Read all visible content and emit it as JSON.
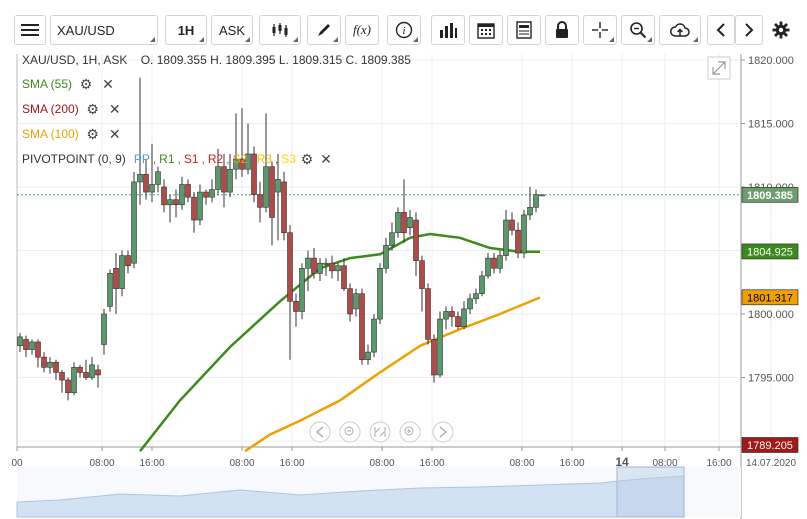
{
  "toolbar": {
    "symbol": "XAU/USD",
    "timeframe": "1H",
    "price_type": "ASK",
    "fx_label": "f(x)"
  },
  "ohlc": {
    "label": "XAU/USD, 1H, ASK",
    "text": "O. 1809.355 H. 1809.395 L. 1809.315 C. 1809.385"
  },
  "indicators": [
    {
      "label": "SMA (55)",
      "color": "#3c8a1c"
    },
    {
      "label": "SMA (200)",
      "color": "#a01818"
    },
    {
      "label": "SMA (100)",
      "color": "#f0a000"
    }
  ],
  "pivot": {
    "label": "PIVOTPOINT (0, 9)",
    "levels": [
      {
        "label": "PP",
        "color": "#4aa0e0"
      },
      {
        "label": "R1",
        "color": "#3c8a1c"
      },
      {
        "label": "S1",
        "color": "#d02020"
      },
      {
        "label": "R2",
        "color": "#d02020"
      },
      {
        "label": "S2",
        "color": "#f0a000"
      },
      {
        "label": "R3",
        "color": "#f0c000"
      },
      {
        "label": "S3",
        "color": "#f0e000"
      }
    ]
  },
  "price_axis": {
    "ticks": [
      "1820.000",
      "1815.000",
      "1810.000",
      "1805.000",
      "1800.000",
      "1795.000",
      "1790.000"
    ],
    "badges": [
      {
        "label": "1809.385",
        "price": 1809.385,
        "bg": "#6b9e6b",
        "fg": "#ffffff"
      },
      {
        "label": "1804.925",
        "price": 1804.925,
        "bg": "#3c8a1c",
        "fg": "#ffffff"
      },
      {
        "label": "1801.317",
        "price": 1801.317,
        "bg": "#f0a000",
        "fg": "#000000"
      },
      {
        "label": "1789.205",
        "price": 1789.205,
        "bg": "#a01818",
        "fg": "#ffffff"
      }
    ]
  },
  "time_axis": {
    "labels": [
      "00",
      "08:00",
      "16:00",
      "08:00",
      "16:00",
      "08:00",
      "16:00",
      "08:00",
      "16:00",
      "14",
      "08:00",
      "16:00",
      "14.07.2020"
    ]
  },
  "chart_data": {
    "type": "candlestick",
    "symbol": "XAU/USD",
    "timeframe": "1H",
    "last_price": 1809.385,
    "ylim": [
      1789.0,
      1821.0
    ],
    "series": [
      {
        "name": "SMA (55)",
        "color": "#3c8a1c",
        "last": 1804.925
      },
      {
        "name": "SMA (100)",
        "color": "#f0a000",
        "last": 1801.317
      },
      {
        "name": "SMA (200)",
        "color": "#a01818",
        "last": 1789.205
      }
    ],
    "sma55_path": [
      [
        140,
        1789.2
      ],
      [
        180,
        1793.2
      ],
      [
        230,
        1797.4
      ],
      [
        280,
        1801.0
      ],
      [
        320,
        1803.6
      ],
      [
        350,
        1804.4
      ],
      [
        380,
        1804.7
      ],
      [
        410,
        1806.0
      ],
      [
        430,
        1806.3
      ],
      [
        460,
        1806.0
      ],
      [
        490,
        1805.2
      ],
      [
        520,
        1804.9
      ],
      [
        540,
        1804.9
      ]
    ],
    "sma100_path": [
      [
        245,
        1789.2
      ],
      [
        270,
        1790.5
      ],
      [
        300,
        1791.6
      ],
      [
        340,
        1793.2
      ],
      [
        380,
        1795.4
      ],
      [
        420,
        1797.5
      ],
      [
        460,
        1798.8
      ],
      [
        500,
        1800.0
      ],
      [
        540,
        1801.3
      ]
    ],
    "candles": [
      [
        20,
        1797.5,
        1798.2,
        1797.0,
        1798.5
      ],
      [
        26,
        1798.0,
        1797.2,
        1796.6,
        1798.3
      ],
      [
        32,
        1797.2,
        1797.8,
        1796.8,
        1798.0
      ],
      [
        38,
        1797.8,
        1796.6,
        1795.8,
        1798.0
      ],
      [
        44,
        1796.6,
        1795.8,
        1795.4,
        1797.0
      ],
      [
        50,
        1795.8,
        1796.2,
        1795.3,
        1796.6
      ],
      [
        56,
        1796.2,
        1795.4,
        1794.8,
        1796.4
      ],
      [
        62,
        1795.4,
        1794.8,
        1793.8,
        1795.6
      ],
      [
        68,
        1794.8,
        1793.8,
        1793.2,
        1795.0
      ],
      [
        74,
        1793.8,
        1795.8,
        1793.6,
        1796.2
      ],
      [
        80,
        1795.8,
        1795.4,
        1795.0,
        1796.0
      ],
      [
        86,
        1795.4,
        1795.0,
        1794.8,
        1796.4
      ],
      [
        92,
        1795.0,
        1796.0,
        1794.8,
        1796.6
      ],
      [
        98,
        1795.6,
        1795.2,
        1794.2,
        1796.0
      ],
      [
        104,
        1797.6,
        1800.0,
        1796.8,
        1800.4
      ],
      [
        110,
        1800.6,
        1803.2,
        1800.2,
        1803.5
      ],
      [
        116,
        1803.6,
        1802.0,
        1800.0,
        1804.8
      ],
      [
        122,
        1802.0,
        1804.6,
        1801.4,
        1805.0
      ],
      [
        128,
        1804.6,
        1803.8,
        1803.2,
        1805.0
      ],
      [
        134,
        1804.0,
        1810.4,
        1803.6,
        1811.2
      ],
      [
        140,
        1810.4,
        1811.0,
        1808.6,
        1818.6
      ],
      [
        146,
        1811.0,
        1809.6,
        1809.0,
        1812.2
      ],
      [
        152,
        1809.6,
        1810.2,
        1808.8,
        1813.4
      ],
      [
        158,
        1810.2,
        1811.2,
        1809.6,
        1811.6
      ],
      [
        164,
        1810.0,
        1808.6,
        1808.0,
        1810.6
      ],
      [
        170,
        1808.6,
        1809.0,
        1807.2,
        1809.4
      ],
      [
        176,
        1809.0,
        1808.6,
        1807.6,
        1809.8
      ],
      [
        182,
        1808.6,
        1810.2,
        1808.2,
        1810.8
      ],
      [
        188,
        1810.2,
        1809.2,
        1808.8,
        1810.6
      ],
      [
        194,
        1809.2,
        1807.4,
        1806.4,
        1809.6
      ],
      [
        200,
        1807.4,
        1809.6,
        1807.0,
        1810.2
      ],
      [
        206,
        1809.6,
        1809.2,
        1808.6,
        1809.8
      ],
      [
        212,
        1809.2,
        1809.8,
        1808.8,
        1810.6
      ],
      [
        218,
        1809.8,
        1811.6,
        1809.4,
        1813.0
      ],
      [
        224,
        1811.6,
        1809.6,
        1808.4,
        1812.6
      ],
      [
        230,
        1809.6,
        1811.4,
        1809.2,
        1812.6
      ],
      [
        236,
        1811.4,
        1812.2,
        1810.6,
        1815.8
      ],
      [
        242,
        1812.2,
        1811.4,
        1810.8,
        1816.2
      ],
      [
        248,
        1811.4,
        1812.6,
        1811.0,
        1815.0
      ],
      [
        254,
        1812.6,
        1809.4,
        1808.8,
        1813.2
      ],
      [
        260,
        1809.4,
        1808.4,
        1807.2,
        1810.4
      ],
      [
        266,
        1808.4,
        1811.6,
        1808.0,
        1815.8
      ],
      [
        272,
        1811.6,
        1807.6,
        1805.4,
        1812.0
      ],
      [
        278,
        1809.6,
        1810.6,
        1805.8,
        1812.6
      ],
      [
        284,
        1810.4,
        1806.4,
        1805.8,
        1811.2
      ],
      [
        290,
        1806.4,
        1801.0,
        1796.4,
        1807.0
      ],
      [
        296,
        1801.0,
        1800.2,
        1799.0,
        1801.6
      ],
      [
        302,
        1800.2,
        1803.6,
        1799.6,
        1804.0
      ],
      [
        308,
        1803.6,
        1804.4,
        1801.8,
        1805.0
      ],
      [
        314,
        1804.4,
        1803.2,
        1802.8,
        1805.2
      ],
      [
        320,
        1803.2,
        1804.0,
        1802.6,
        1804.4
      ],
      [
        326,
        1804.0,
        1804.0,
        1803.0,
        1804.4
      ],
      [
        332,
        1804.0,
        1803.4,
        1802.8,
        1804.6
      ],
      [
        338,
        1803.4,
        1803.8,
        1802.6,
        1804.0
      ],
      [
        344,
        1803.8,
        1802.0,
        1801.8,
        1804.4
      ],
      [
        350,
        1802.0,
        1800.0,
        1799.4,
        1802.4
      ],
      [
        356,
        1800.4,
        1801.6,
        1799.8,
        1802.0
      ],
      [
        362,
        1801.6,
        1796.4,
        1796.0,
        1802.0
      ],
      [
        368,
        1796.4,
        1797.0,
        1796.0,
        1797.6
      ],
      [
        374,
        1797.0,
        1799.6,
        1796.6,
        1800.0
      ],
      [
        380,
        1799.6,
        1803.6,
        1799.2,
        1804.0
      ],
      [
        386,
        1803.6,
        1805.4,
        1803.2,
        1806.0
      ],
      [
        392,
        1805.4,
        1806.4,
        1805.0,
        1807.2
      ],
      [
        398,
        1806.4,
        1808.0,
        1806.0,
        1808.4
      ],
      [
        404,
        1808.0,
        1806.4,
        1805.6,
        1810.6
      ],
      [
        410,
        1806.8,
        1807.6,
        1806.2,
        1808.2
      ],
      [
        416,
        1807.4,
        1804.2,
        1803.0,
        1808.0
      ],
      [
        422,
        1804.2,
        1802.0,
        1800.2,
        1804.6
      ],
      [
        428,
        1802.0,
        1798.0,
        1797.6,
        1802.4
      ],
      [
        434,
        1798.0,
        1795.2,
        1794.6,
        1798.4
      ],
      [
        440,
        1795.2,
        1799.6,
        1795.0,
        1800.2
      ],
      [
        446,
        1799.6,
        1800.2,
        1798.8,
        1800.6
      ],
      [
        452,
        1800.2,
        1799.8,
        1799.0,
        1800.6
      ],
      [
        458,
        1799.8,
        1799.0,
        1798.8,
        1800.2
      ],
      [
        464,
        1799.0,
        1800.4,
        1798.8,
        1801.0
      ],
      [
        470,
        1800.4,
        1801.2,
        1800.0,
        1801.6
      ],
      [
        476,
        1801.2,
        1801.6,
        1800.8,
        1802.0
      ],
      [
        482,
        1801.6,
        1803.0,
        1801.4,
        1803.4
      ],
      [
        488,
        1803.0,
        1804.4,
        1802.8,
        1804.8
      ],
      [
        494,
        1804.4,
        1803.6,
        1803.2,
        1804.8
      ],
      [
        500,
        1803.6,
        1804.6,
        1803.2,
        1805.0
      ],
      [
        506,
        1804.6,
        1807.4,
        1804.2,
        1808.2
      ],
      [
        512,
        1807.4,
        1806.6,
        1806.2,
        1808.0
      ],
      [
        518,
        1806.6,
        1804.8,
        1804.4,
        1807.2
      ],
      [
        524,
        1804.8,
        1807.8,
        1804.4,
        1808.2
      ],
      [
        530,
        1807.8,
        1808.4,
        1807.4,
        1810.0
      ],
      [
        536,
        1808.4,
        1809.4,
        1808.0,
        1809.8
      ],
      [
        542,
        1809.35,
        1809.39,
        1809.3,
        1809.4
      ]
    ]
  }
}
